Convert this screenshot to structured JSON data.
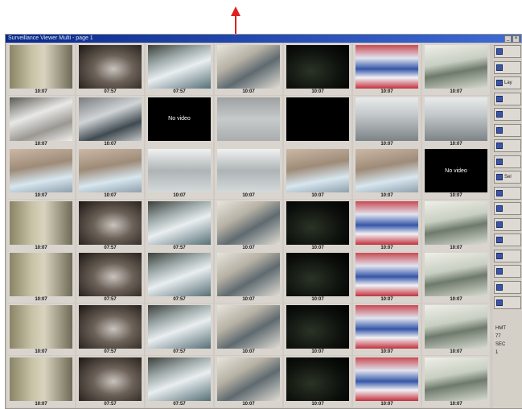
{
  "window": {
    "title": "Surveillance Viewer Multi - page 1"
  },
  "annotation": {
    "arrow_color": "#e0201e"
  },
  "no_video_text": "No video",
  "grid": {
    "rows": [
      [
        {
          "scene": "s1",
          "label": "10:07"
        },
        {
          "scene": "s2",
          "label": "07:57"
        },
        {
          "scene": "s3",
          "label": "07:57"
        },
        {
          "scene": "s4",
          "label": "10:07"
        },
        {
          "scene": "s5",
          "label": "10:07"
        },
        {
          "scene": "s6",
          "label": "10:07"
        },
        {
          "scene": "s7",
          "label": "10:07"
        }
      ],
      [
        {
          "scene": "s8",
          "label": "10:07"
        },
        {
          "scene": "s9",
          "label": "10:07"
        },
        {
          "scene": "novideo",
          "label": ""
        },
        {
          "scene": "s10",
          "label": ""
        },
        {
          "scene": "black",
          "label": ""
        },
        {
          "scene": "s11",
          "label": "10:07"
        },
        {
          "scene": "s11",
          "label": "10:07"
        }
      ],
      [
        {
          "scene": "s12",
          "label": "10:07"
        },
        {
          "scene": "s12",
          "label": "10:07"
        },
        {
          "scene": "s13",
          "label": "10:07"
        },
        {
          "scene": "s13",
          "label": "10:07"
        },
        {
          "scene": "s12",
          "label": "10:07"
        },
        {
          "scene": "s12",
          "label": "10:07"
        },
        {
          "scene": "novideo",
          "label": "10:07"
        }
      ],
      [
        {
          "scene": "s1",
          "label": "10:07"
        },
        {
          "scene": "s2",
          "label": "07:57"
        },
        {
          "scene": "s3",
          "label": "07:57"
        },
        {
          "scene": "s4",
          "label": "10:07"
        },
        {
          "scene": "s5",
          "label": "10:07"
        },
        {
          "scene": "s6",
          "label": "10:07"
        },
        {
          "scene": "s7",
          "label": "10:07"
        }
      ],
      [
        {
          "scene": "s1",
          "label": "10:07"
        },
        {
          "scene": "s2",
          "label": "07:57"
        },
        {
          "scene": "s3",
          "label": "07:57"
        },
        {
          "scene": "s4",
          "label": "10:07"
        },
        {
          "scene": "s5",
          "label": "10:07"
        },
        {
          "scene": "s6",
          "label": "10:07"
        },
        {
          "scene": "s7",
          "label": "10:07"
        }
      ],
      [
        {
          "scene": "s1",
          "label": "10:07"
        },
        {
          "scene": "s2",
          "label": "07:57"
        },
        {
          "scene": "s3",
          "label": "07:57"
        },
        {
          "scene": "s4",
          "label": "10:07"
        },
        {
          "scene": "s5",
          "label": "10:07"
        },
        {
          "scene": "s6",
          "label": "10:07"
        },
        {
          "scene": "s7",
          "label": "10:07"
        }
      ],
      [
        {
          "scene": "s1",
          "label": "10:07"
        },
        {
          "scene": "s2",
          "label": "07:57"
        },
        {
          "scene": "s3",
          "label": "07:57"
        },
        {
          "scene": "s4",
          "label": "10:07"
        },
        {
          "scene": "s5",
          "label": "10:07"
        },
        {
          "scene": "s6",
          "label": "10:07"
        },
        {
          "scene": "s7",
          "label": "10:07"
        }
      ]
    ]
  },
  "sidepanel": {
    "buttons": [
      "",
      "",
      "Lay",
      "",
      "",
      "",
      "",
      "",
      "Sel",
      "",
      "",
      "",
      "",
      "",
      "",
      "",
      ""
    ],
    "info": [
      "HMT",
      "77",
      "SEC",
      "1"
    ]
  }
}
